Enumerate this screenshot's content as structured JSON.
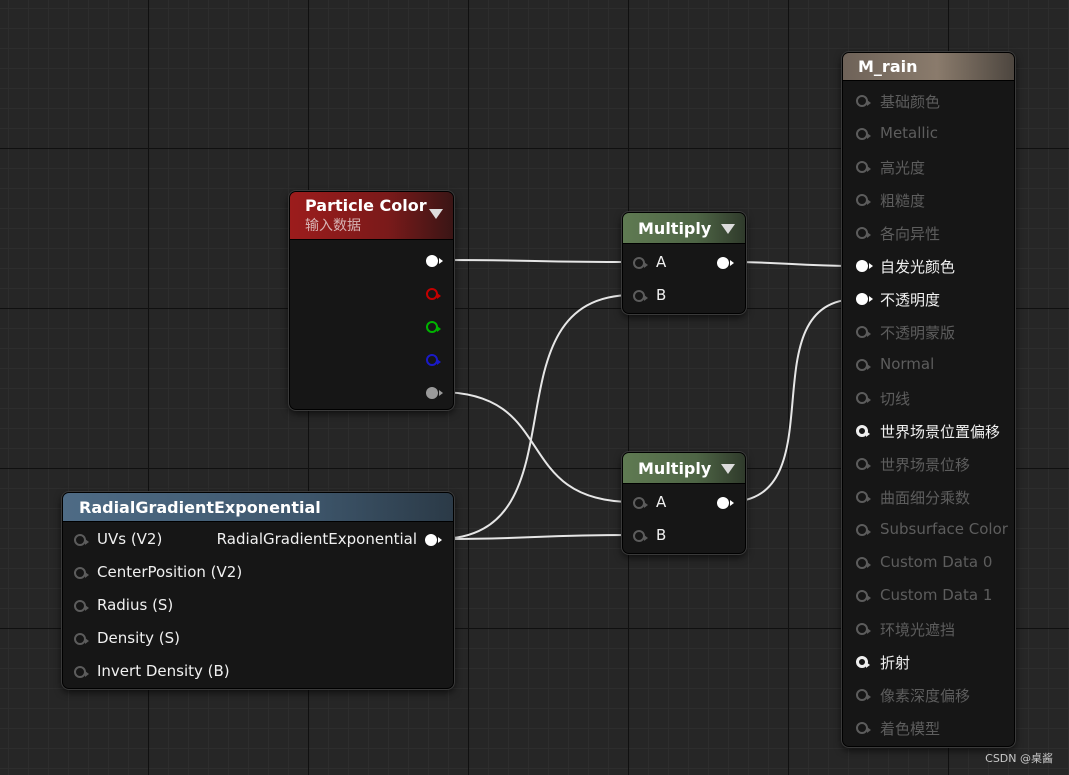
{
  "particle_color": {
    "title": "Particle Color",
    "subtitle": "输入数据"
  },
  "radial": {
    "title": "RadialGradientExponential",
    "inputs": [
      "UVs (V2)",
      "CenterPosition (V2)",
      "Radius (S)",
      "Density (S)",
      "Invert Density (B)"
    ],
    "output": "RadialGradientExponential"
  },
  "multiply_top": {
    "title": "Multiply",
    "input_a": "A",
    "input_b": "B"
  },
  "multiply_bottom": {
    "title": "Multiply",
    "input_a": "A",
    "input_b": "B"
  },
  "material": {
    "title": "M_rain",
    "inputs": [
      {
        "label": "基础颜色",
        "active": false
      },
      {
        "label": "Metallic",
        "active": false
      },
      {
        "label": "高光度",
        "active": false
      },
      {
        "label": "粗糙度",
        "active": false
      },
      {
        "label": "各向异性",
        "active": false
      },
      {
        "label": "自发光颜色",
        "active": true
      },
      {
        "label": "不透明度",
        "active": true
      },
      {
        "label": "不透明蒙版",
        "active": false
      },
      {
        "label": "Normal",
        "active": false
      },
      {
        "label": "切线",
        "active": false
      },
      {
        "label": "世界场景位置偏移",
        "active": true
      },
      {
        "label": "世界场景位移",
        "active": false
      },
      {
        "label": "曲面细分乘数",
        "active": false
      },
      {
        "label": "Subsurface Color",
        "active": false
      },
      {
        "label": "Custom Data 0",
        "active": false
      },
      {
        "label": "Custom Data 1",
        "active": false
      },
      {
        "label": "环境光遮挡",
        "active": false
      },
      {
        "label": "折射",
        "active": true
      },
      {
        "label": "像素深度偏移",
        "active": false
      },
      {
        "label": "着色模型",
        "active": false
      }
    ]
  },
  "watermark": "CSDN @桌酱",
  "colors": {
    "particle_header": "#9c1c1c",
    "multiply_header": "#5f7a52",
    "radial_header": "#4e6b85",
    "material_header": "#6e6258",
    "wire": "#e6e6e6"
  }
}
